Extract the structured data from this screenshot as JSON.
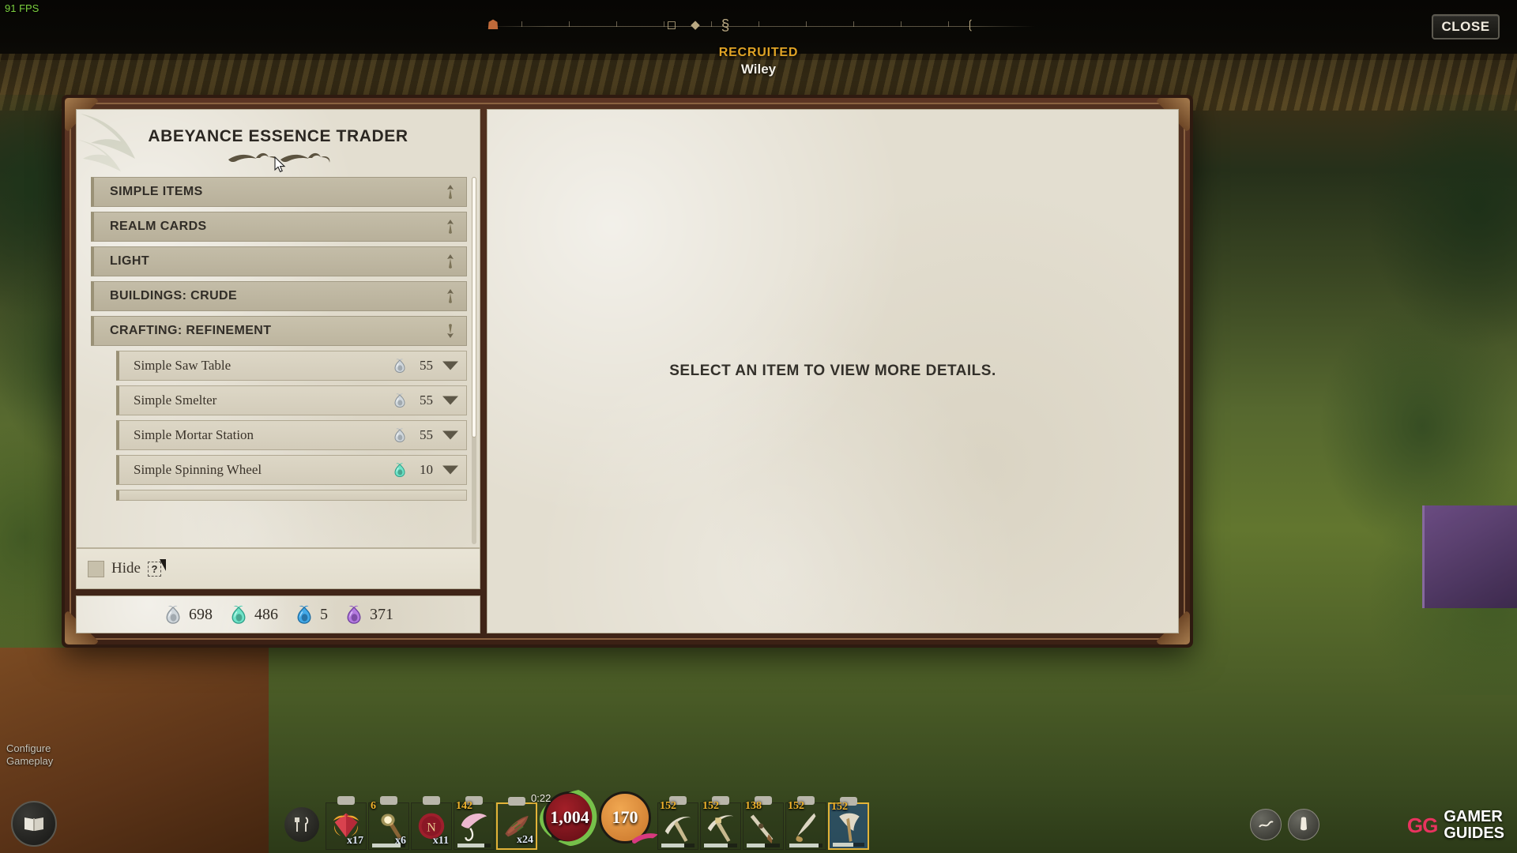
{
  "hud_top": {
    "fps": "91 FPS",
    "close_label": "CLOSE",
    "compass_icons": [
      "home-icon",
      "diamond-icon",
      "circle-icon",
      "key-icon",
      "anchor-icon"
    ]
  },
  "toast": {
    "label": "RECRUITED",
    "name": "Wiley"
  },
  "trader": {
    "title": "ABEYANCE ESSENCE TRADER",
    "categories": [
      {
        "label": "SIMPLE ITEMS",
        "open": false,
        "items": []
      },
      {
        "label": "REALM CARDS",
        "open": false,
        "items": []
      },
      {
        "label": "LIGHT",
        "open": false,
        "items": []
      },
      {
        "label": "BUILDINGS: CRUDE",
        "open": false,
        "items": []
      },
      {
        "label": "CRAFTING: REFINEMENT",
        "open": true,
        "items": [
          {
            "name": "Simple Saw Table",
            "price": "55",
            "currency": "silver"
          },
          {
            "name": "Simple Smelter",
            "price": "55",
            "currency": "silver"
          },
          {
            "name": "Simple Mortar Station",
            "price": "55",
            "currency": "silver"
          },
          {
            "name": "Simple Spinning Wheel",
            "price": "10",
            "currency": "teal"
          }
        ]
      }
    ],
    "hide_label": "Hide",
    "hide_checked": false,
    "help_badge": "?",
    "currencies": [
      {
        "type": "silver",
        "value": "698"
      },
      {
        "type": "teal",
        "value": "486"
      },
      {
        "type": "blue",
        "value": "5"
      },
      {
        "type": "purple",
        "value": "371"
      }
    ]
  },
  "detail_panel": {
    "empty_text": "SELECT AN ITEM TO VIEW MORE DETAILS."
  },
  "hud_bottom": {
    "timer": "0:22",
    "health": "1,004",
    "stamina": "170",
    "hotbar": [
      {
        "key": "1",
        "icon": "gem-icon",
        "qty": "x17",
        "badge": "",
        "durability": 0
      },
      {
        "key": "2",
        "icon": "torch-icon",
        "qty": "x6",
        "badge": "6",
        "durability": 85
      },
      {
        "key": "3",
        "icon": "wax-seal-icon",
        "qty": "x11",
        "badge": "",
        "durability": 0
      },
      {
        "key": "4",
        "icon": "umbrella-icon",
        "qty": "",
        "badge": "142",
        "durability": 80
      },
      {
        "key": "5",
        "icon": "meat-icon",
        "qty": "x24",
        "badge": "",
        "durability": 0,
        "selected": true
      }
    ],
    "tools": [
      {
        "icon": "pickaxe-icon",
        "badge": "152",
        "durability": 70
      },
      {
        "icon": "pickaxe-icon",
        "badge": "152",
        "durability": 72
      },
      {
        "icon": "musket-icon",
        "badge": "138",
        "durability": 55
      },
      {
        "icon": "dagger-icon",
        "badge": "152",
        "durability": 88
      },
      {
        "icon": "axe-icon",
        "badge": "152",
        "durability": 65,
        "selected": true
      }
    ],
    "right_buttons": [
      "wave-icon",
      "lantern-icon"
    ]
  },
  "overlay": {
    "configure_line1": "Configure",
    "configure_line2": "Gameplay"
  },
  "watermark": {
    "logo": "GG",
    "line1": "GAMER",
    "line2": "GUIDES"
  },
  "colors": {
    "parchment": "#e3ded0",
    "frame_wood": "#4a2a1b",
    "accent_gold": "#e0a325",
    "health_red": "#a31f28",
    "stamina_orange": "#f0a751",
    "essence_silver": "#cfd6db",
    "essence_teal": "#4fd9c0",
    "essence_blue": "#2f9fe0",
    "essence_purple": "#a86ed8"
  }
}
